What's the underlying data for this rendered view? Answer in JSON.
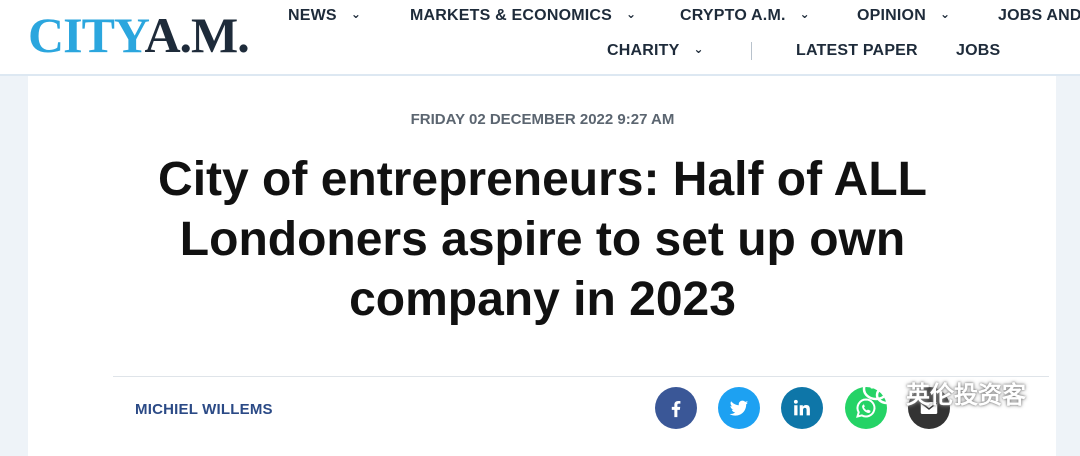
{
  "logo": {
    "part1": "CITY",
    "part2": "A.M."
  },
  "nav": {
    "row1": [
      {
        "label": "NEWS",
        "dropdown": true
      },
      {
        "label": "MARKETS & ECONOMICS",
        "dropdown": true
      },
      {
        "label": "CRYPTO A.M.",
        "dropdown": true
      },
      {
        "label": "OPINION",
        "dropdown": true
      },
      {
        "label": "JOBS AND",
        "dropdown": false
      }
    ],
    "row2": [
      {
        "label": "CHARITY",
        "dropdown": true
      },
      {
        "label": "LATEST PAPER",
        "dropdown": false
      },
      {
        "label": "JOBS",
        "dropdown": false
      }
    ]
  },
  "article": {
    "date": "FRIDAY 02 DECEMBER 2022 9:27 AM",
    "headline_lines": [
      "City of entrepreneurs: Half of ALL",
      "Londoners aspire to set up own",
      "company in 2023"
    ],
    "author": "MICHIEL WILLEMS"
  },
  "share": {
    "facebook": {
      "icon": "facebook-icon",
      "color": "#3a5797"
    },
    "twitter": {
      "icon": "twitter-icon",
      "color": "#1da1f2"
    },
    "linkedin": {
      "icon": "linkedin-icon",
      "color": "#0e76a8"
    },
    "whatsapp": {
      "icon": "whatsapp-icon",
      "color": "#25d366"
    },
    "email": {
      "icon": "email-icon",
      "color": "#333333"
    }
  },
  "watermark": {
    "text": "英伦投资客"
  },
  "colors": {
    "brand_blue": "#2ba6de",
    "brand_dark": "#1e2b3a",
    "author_blue": "#2b4a86"
  }
}
